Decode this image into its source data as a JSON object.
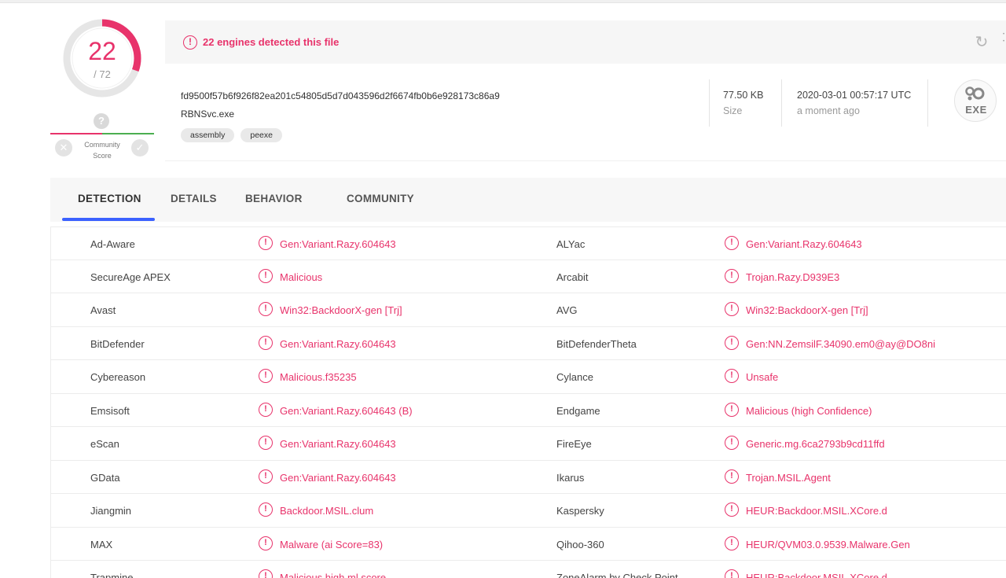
{
  "score": {
    "detected": "22",
    "total": "/ 72",
    "detected_fraction": 0.3056,
    "ring_color": "#e8336b"
  },
  "community": {
    "question_glyph": "?",
    "label_line1": "Community",
    "label_line2": "Score",
    "down_glyph": "✕",
    "up_glyph": "✓"
  },
  "alert": {
    "icon_glyph": "!",
    "text": "22 engines detected this file",
    "reanalyze_icon": "↻"
  },
  "file": {
    "hash": "fd9500f57b6f926f82ea201c54805d5d7d043596d2f6674fb0b6e928173c86a9",
    "name": "RBNSvc.exe",
    "tags": [
      "assembly",
      "peexe"
    ],
    "size_value": "77.50 KB",
    "size_label": "Size",
    "date_value": "2020-03-01 00:57:17 UTC",
    "date_label": "a moment ago",
    "type_label": "EXE"
  },
  "tabs": [
    "DETECTION",
    "DETAILS",
    "BEHAVIOR",
    "COMMUNITY"
  ],
  "detections": [
    {
      "left_engine": "Ad-Aware",
      "left_result": "Gen:Variant.Razy.604643",
      "right_engine": "ALYac",
      "right_result": "Gen:Variant.Razy.604643"
    },
    {
      "left_engine": "SecureAge APEX",
      "left_result": "Malicious",
      "right_engine": "Arcabit",
      "right_result": "Trojan.Razy.D939E3"
    },
    {
      "left_engine": "Avast",
      "left_result": "Win32:BackdoorX-gen [Trj]",
      "right_engine": "AVG",
      "right_result": "Win32:BackdoorX-gen [Trj]"
    },
    {
      "left_engine": "BitDefender",
      "left_result": "Gen:Variant.Razy.604643",
      "right_engine": "BitDefenderTheta",
      "right_result": "Gen:NN.ZemsilF.34090.em0@ay@DO8ni"
    },
    {
      "left_engine": "Cybereason",
      "left_result": "Malicious.f35235",
      "right_engine": "Cylance",
      "right_result": "Unsafe"
    },
    {
      "left_engine": "Emsisoft",
      "left_result": "Gen:Variant.Razy.604643 (B)",
      "right_engine": "Endgame",
      "right_result": "Malicious (high Confidence)"
    },
    {
      "left_engine": "eScan",
      "left_result": "Gen:Variant.Razy.604643",
      "right_engine": "FireEye",
      "right_result": "Generic.mg.6ca2793b9cd11ffd"
    },
    {
      "left_engine": "GData",
      "left_result": "Gen:Variant.Razy.604643",
      "right_engine": "Ikarus",
      "right_result": "Trojan.MSIL.Agent"
    },
    {
      "left_engine": "Jiangmin",
      "left_result": "Backdoor.MSIL.clum",
      "right_engine": "Kaspersky",
      "right_result": "HEUR:Backdoor.MSIL.XCore.d"
    },
    {
      "left_engine": "MAX",
      "left_result": "Malware (ai Score=83)",
      "right_engine": "Qihoo-360",
      "right_result": "HEUR/QVM03.0.9539.Malware.Gen"
    },
    {
      "left_engine": "Trapmine",
      "left_result": "Malicious.high.ml.score",
      "right_engine": "ZoneAlarm by Check Point",
      "right_result": "HEUR:Backdoor.MSIL.XCore.d"
    }
  ],
  "result_icon_glyph": "!",
  "colors": {
    "malicious": "#e8336b",
    "tab_accent": "#3b61ff",
    "harmless": "#4caf50"
  },
  "icons": {
    "alert": "alert-circle-icon",
    "reanalyze": "refresh-icon",
    "file_type": "exe-file-icon"
  }
}
